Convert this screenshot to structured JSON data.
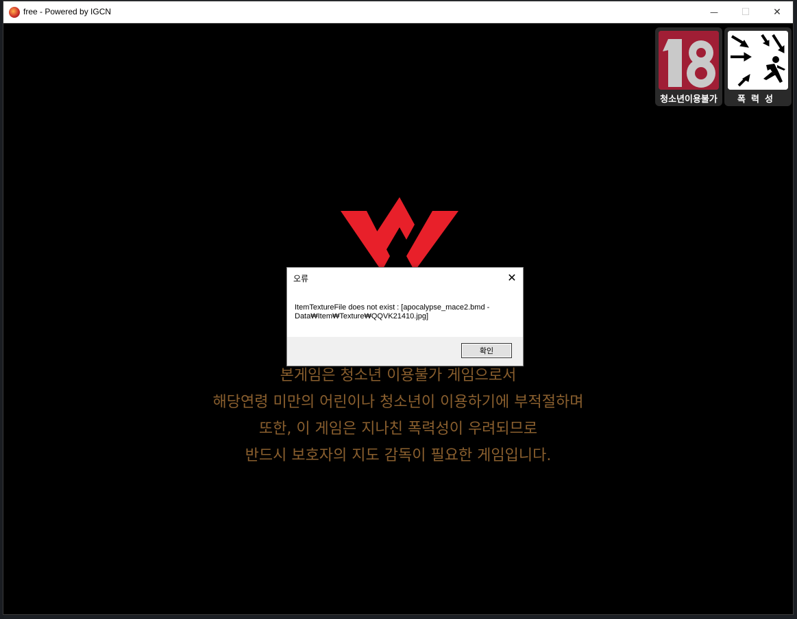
{
  "window": {
    "title": "free - Powered by IGCN",
    "minimize_glyph": "—",
    "maximize_glyph": "☐",
    "close_glyph": "✕"
  },
  "ratings": {
    "age": {
      "number": "18",
      "label": "청소년이용불가"
    },
    "violence": {
      "label": "폭력성"
    }
  },
  "warning_lines": [
    "본게임은 청소년 이용불가 게임으로서",
    "해당연령 미만의 어린이나 청소년이 이용하기에 부적절하며",
    "또한, 이 게임은 지나친 폭력성이 우려되므로",
    "반드시 보호자의 지도 감독이 필요한 게임입니다."
  ],
  "dialog": {
    "title": "오류",
    "close_glyph": "✕",
    "message_line1": "ItemTextureFile does not exist : [apocalypse_mace2.bmd -",
    "message_line2": "Data₩Item₩Texture₩QQVK21410.jpg]",
    "ok_label": "확인"
  },
  "colors": {
    "logo_red": "#e8202a",
    "warning_text": "#8a5f2e",
    "rating_red": "#a01e35"
  }
}
